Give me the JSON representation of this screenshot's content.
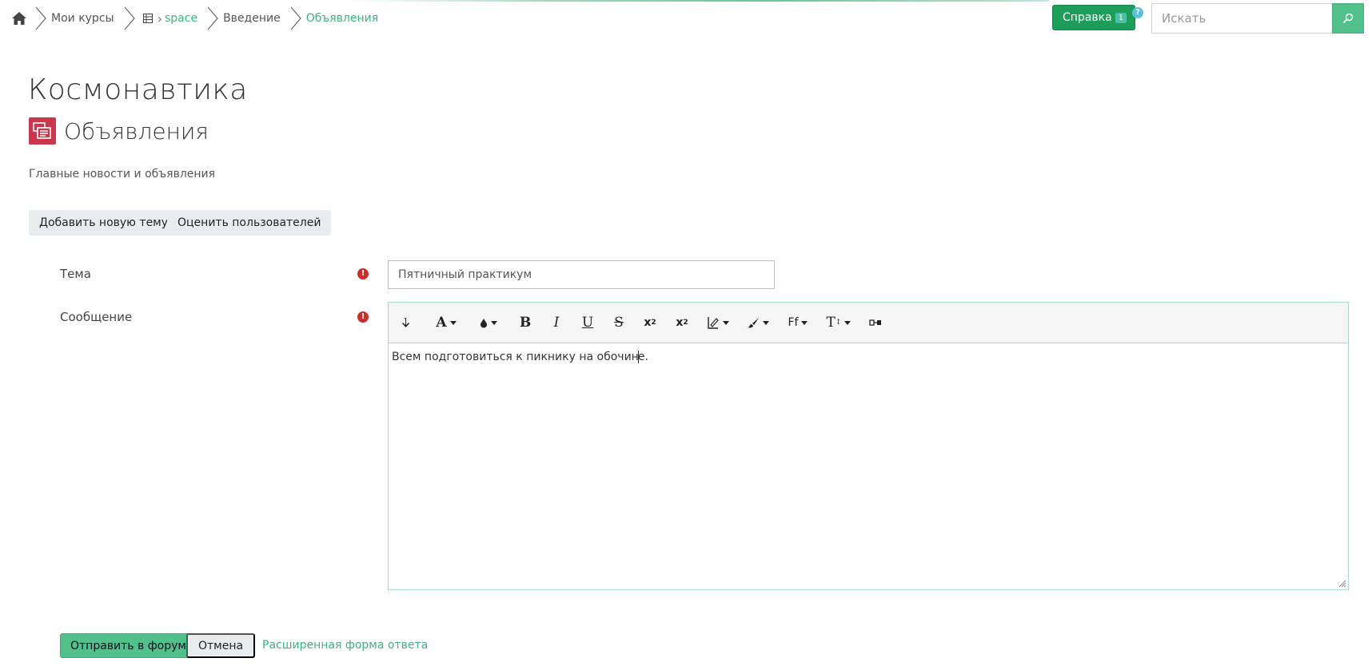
{
  "breadcrumb": {
    "items": [
      "Мои курсы",
      "space",
      "Введение",
      "Объявления"
    ]
  },
  "header": {
    "help_label": "Справка",
    "help_badge": "1",
    "help_q": "?",
    "search_placeholder": "Искать"
  },
  "course": {
    "title": "Космонавтика"
  },
  "forum": {
    "title": "Объявления",
    "description": "Главные новости и объявления",
    "add_topic_label": "Добавить новую тему",
    "rate_users_label": "Оценить пользователей"
  },
  "form": {
    "subject_label": "Тема",
    "subject_value": "Пятничный практикум",
    "message_label": "Сообщение",
    "message_before_cursor": "Всем подготовиться к пикнику на обочин",
    "message_after_cursor": "е.",
    "toolbar_icons": [
      "collapse-icon",
      "font-color-icon",
      "background-color-icon",
      "bold-icon",
      "italic-icon",
      "underline-icon",
      "strikethrough-icon",
      "subscript-icon",
      "superscript-icon",
      "align-icon",
      "paint-brush-icon",
      "font-family-icon",
      "font-size-icon",
      "html-code-icon"
    ],
    "submit_label": "Отправить в форум",
    "cancel_label": "Отмена",
    "advanced_label": "Расширенная форма ответа"
  },
  "colors": {
    "accent_green": "#52c08a",
    "help_green": "#1e9c5a",
    "forum_icon_red": "#c8374c",
    "required_red": "#c9302c"
  }
}
